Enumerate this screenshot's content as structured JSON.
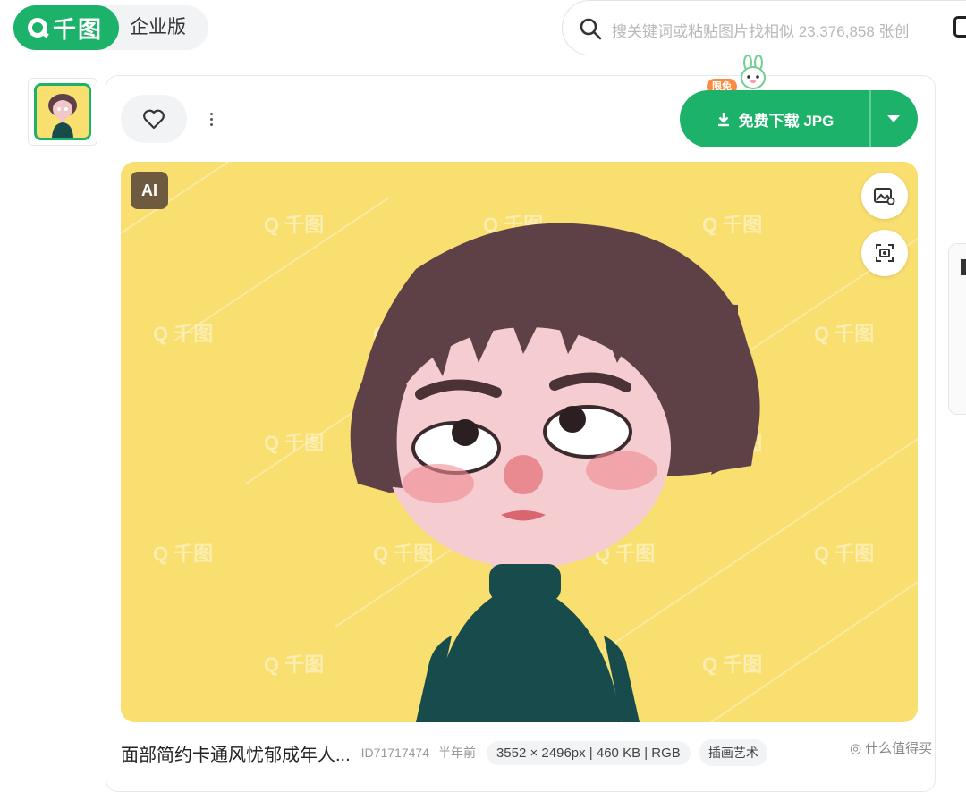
{
  "header": {
    "logo_text": "千图",
    "enterprise_label": "企业版",
    "search_placeholder": "搜关键词或粘贴图片找相似 23,376,858 张创"
  },
  "toolbar": {
    "favorite_icon": "heart-icon",
    "more_icon": "more-vertical-icon",
    "download_label": "免费下载 JPG",
    "badge_label": "限免",
    "dropdown_icon": "caret-down-icon"
  },
  "image": {
    "watermark_text": "千图",
    "ai_badge": "AI",
    "side_icons": [
      "image-search-icon",
      "camera-scan-icon"
    ]
  },
  "meta": {
    "title": "面部简约卡通风忧郁成年人...",
    "id": "ID71717474",
    "time": "半年前",
    "spec": "3552 × 2496px | 460 KB | RGB",
    "tag": "插画艺术",
    "site_watermark": "什么值得买"
  },
  "colors": {
    "brand": "#1cb26a",
    "hero_bg": "#f9df6f",
    "badge": "#ff8a3d"
  }
}
